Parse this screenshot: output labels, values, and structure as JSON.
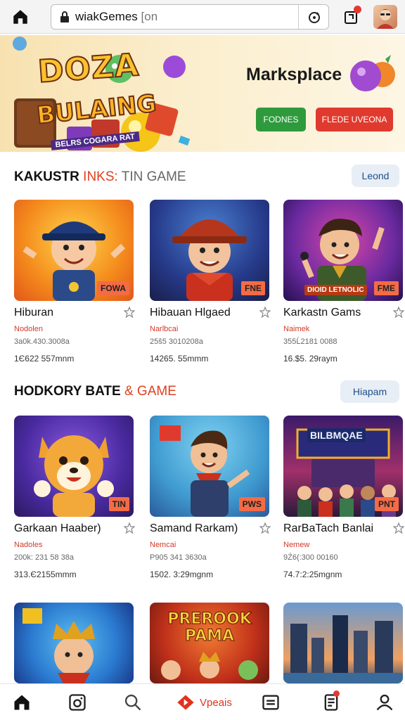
{
  "browser": {
    "url_text": "wiakGemes",
    "url_suffix": "on",
    "url_caret": "[",
    "icons": [
      "home-icon",
      "lock-icon",
      "reload-icon",
      "notification-icon",
      "avatar"
    ]
  },
  "banner": {
    "logo_line1": "DOZA",
    "logo_line2": "BULAING",
    "logo_sub": "BELRS COGARA RAT",
    "title": "Marksplace",
    "btn_primary": "FODNES",
    "btn_secondary": "FLEDE UVEONA"
  },
  "section1": {
    "title_bold": "KAKUSTR",
    "title_accent": "INKS:",
    "title_light": "TIN GAME",
    "button": "Leond",
    "cards": [
      {
        "title": "Hiburan",
        "category": "Nodolen",
        "meta": "3a0k.430.3008a",
        "stat": "1Є622 557mnm",
        "badge": "FOWA"
      },
      {
        "title": "Hibauan Hlgaed",
        "category": "Narlbcai",
        "meta": "25ŝ5 3010208a",
        "stat": "14265. 55mmm",
        "badge": "FNE"
      },
      {
        "title": "Karkastn Gams",
        "category": "Naimek",
        "meta": "355Ĺ2181 0088",
        "stat": "16.$5. 29raym",
        "badge": "FME",
        "banner": "DIOID LETNOLIC"
      }
    ]
  },
  "section2": {
    "title_bold": "HODKORY BATE",
    "title_accent": "&",
    "title_light": "GAME",
    "button": "Hiapam",
    "cards": [
      {
        "title": "Garkaan Haaber)",
        "category": "Nadoles",
        "meta": "200k: 231 58 38a",
        "stat": "313.Є2155mmm",
        "badge": "TIN"
      },
      {
        "title": "Samand Rarkam)",
        "category": "Nemcai",
        "meta": "P905 341 3630a",
        "stat": "1502. 3:29mgnm",
        "badge": "PWS"
      },
      {
        "title": "RarBaTach Banlai",
        "category": "Nemew",
        "meta": "9Ź6(:300 00160",
        "stat": "74.7:2:25mgnm",
        "badge": "PNT",
        "banner": "BILBMQAE"
      }
    ]
  },
  "section3": {
    "cards": [
      {
        "label": ""
      },
      {
        "label": "PREROOK PAMA"
      },
      {
        "label": ""
      }
    ]
  },
  "bottom_nav": {
    "items": [
      "home",
      "media",
      "search",
      "live",
      "news",
      "notes",
      "profile"
    ],
    "live_label": "Vpeais"
  },
  "colors": {
    "accent": "#e0401f",
    "green": "#2e9a3c",
    "red": "#e03a2e",
    "link": "#1c4e8a"
  }
}
